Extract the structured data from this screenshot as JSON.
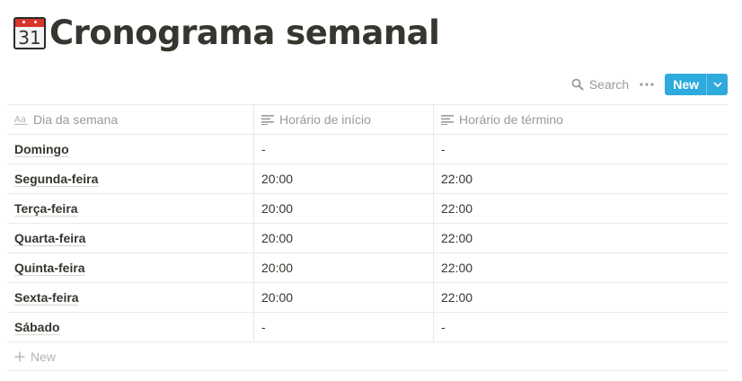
{
  "page": {
    "icon": "calendar-icon",
    "icon_day": "31",
    "title": "Cronograma semanal"
  },
  "toolbar": {
    "search_label": "Search",
    "more_icon": "ellipsis-icon",
    "new_label": "New",
    "accent_color": "#2eaadc"
  },
  "table": {
    "columns": [
      {
        "label": "Dia da semana",
        "icon": "title-property-icon"
      },
      {
        "label": "Horário de início",
        "icon": "text-property-icon"
      },
      {
        "label": "Horário de término",
        "icon": "text-property-icon"
      }
    ],
    "rows": [
      {
        "dia": "Domingo",
        "inicio": "-",
        "termino": "-"
      },
      {
        "dia": "Segunda-feira",
        "inicio": "20:00",
        "termino": "22:00"
      },
      {
        "dia": "Terça-feira",
        "inicio": "20:00",
        "termino": "22:00"
      },
      {
        "dia": "Quarta-feira",
        "inicio": "20:00",
        "termino": "22:00"
      },
      {
        "dia": "Quinta-feira",
        "inicio": "20:00",
        "termino": "22:00"
      },
      {
        "dia": "Sexta-feira",
        "inicio": "20:00",
        "termino": "22:00"
      },
      {
        "dia": "Sábado",
        "inicio": "-",
        "termino": "-"
      }
    ],
    "add_row_label": "New"
  }
}
